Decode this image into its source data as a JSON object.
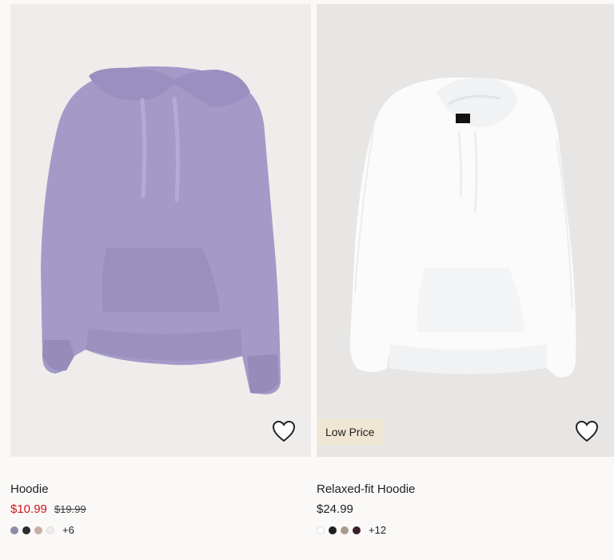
{
  "products": [
    {
      "name": "Hoodie",
      "price_sale": "$10.99",
      "price_old": "$19.99",
      "swatch_colors": [
        "#8f8aa6",
        "#2b2b30",
        "#c9aea3",
        "#eeecec"
      ],
      "more_colors": "+6",
      "favorite_icon": "heart-outline-icon",
      "hoodie_color": "#a49ac8"
    },
    {
      "name": "Relaxed-fit Hoodie",
      "price": "$24.99",
      "badge": "Low Price",
      "swatch_colors": [
        "#ffffff",
        "#1f1f1f",
        "#a79b8c",
        "#3c1f2a"
      ],
      "more_colors": "+12",
      "favorite_icon": "heart-outline-icon",
      "hoodie_color": "#fbfbfc"
    }
  ]
}
